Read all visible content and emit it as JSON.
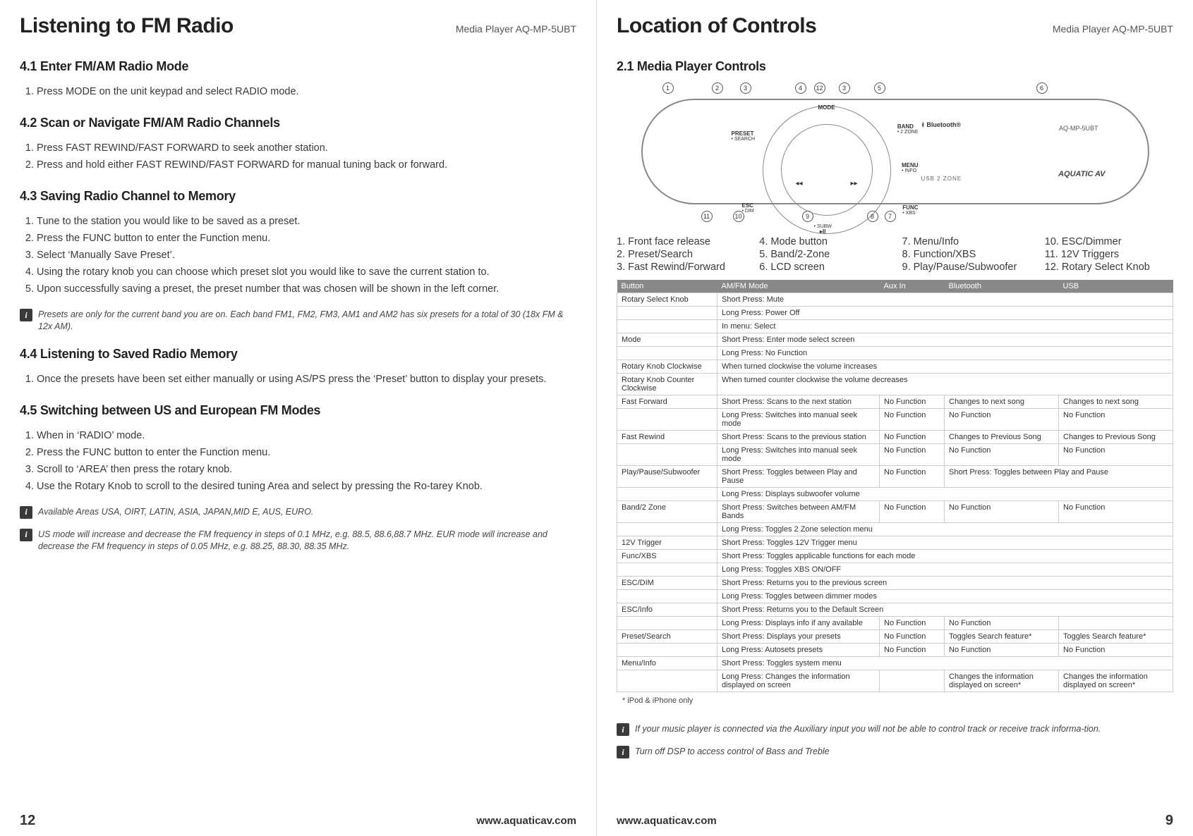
{
  "left": {
    "title": "Listening to FM Radio",
    "model": "Media Player AQ-MP-5UBT",
    "s41": "4.1 Enter FM/AM Radio Mode",
    "s41_1": "Press MODE on the unit keypad and select RADIO mode.",
    "s42": "4.2 Scan or Navigate FM/AM Radio Channels",
    "s42_1": "Press FAST REWIND/FAST FORWARD to seek another station.",
    "s42_2": "Press and hold either FAST REWIND/FAST FORWARD for manual tuning back or forward.",
    "s43": "4.3 Saving Radio Channel to Memory",
    "s43_1": "Tune to the station you would like to be saved as a preset.",
    "s43_2": "Press the FUNC button to enter the Function menu.",
    "s43_3": "Select ‘Manually Save Preset’.",
    "s43_4": "Using the rotary knob you can choose which preset slot you would like to save the current station to.",
    "s43_5": "Upon successfully saving a preset, the preset number that was chosen will be shown in the left corner.",
    "s43_note": "Presets are only for the current band you are on. Each band FM1, FM2, FM3, AM1 and AM2 has six presets for a total of 30 (18x FM & 12x AM).",
    "s44": "4.4 Listening to Saved Radio Memory",
    "s44_1": "Once the presets have been set either manually or using AS/PS press the ‘Preset’ button to display your presets.",
    "s45": "4.5 Switching between US and European FM Modes",
    "s45_1": "When in ‘RADIO’ mode.",
    "s45_2": "Press the FUNC button to enter the Function menu.",
    "s45_3": "Scroll to ‘AREA’ then press the rotary knob.",
    "s45_4": "Use the Rotary Knob to scroll to the desired tuning Area and select by pressing the Ro-tarey Knob.",
    "s45_note1": "Available Areas USA, OIRT, LATIN, ASIA, JAPAN,MID E, AUS, EURO.",
    "s45_note2": "US mode will increase and decrease the FM frequency in steps of 0.1 MHz, e.g. 88.5, 88.6,88.7 MHz. EUR mode will increase and decrease the FM frequency in steps of 0.05 MHz, e.g. 88.25, 88.30, 88.35 MHz.",
    "page_num": "12",
    "url": "www.aquaticav.com"
  },
  "right": {
    "title": "Location of Controls",
    "model": "Media Player AQ-MP-5UBT",
    "s21": "2.1 Media Player Controls",
    "device": {
      "model": "AQ-MP-5UBT",
      "brand": "AQUATIC AV",
      "bt": "Bluetooth",
      "usb2zone": "USB   2 ZONE",
      "knob": {
        "preset": "PRESET",
        "preset_sub": "• SEARCH",
        "mode": "MODE",
        "band": "BAND",
        "band_sub": "• 2 ZONE",
        "menu": "MENU",
        "menu_sub": "• INFO",
        "func": "FUNC",
        "func_sub": "• XBS",
        "subw": "• SUBW",
        "esc": "ESC",
        "esc_sub": "• DIM"
      }
    },
    "legend": {
      "c1a": "1. Front face release",
      "c1b": "2. Preset/Search",
      "c1c": "3. Fast Rewind/Forward",
      "c2a": "4. Mode button",
      "c2b": "5. Band/2-Zone",
      "c2c": "6. LCD screen",
      "c3a": "7. Menu/Info",
      "c3b": "8. Function/XBS",
      "c3c": "9. Play/Pause/Subwoofer",
      "c4a": "10. ESC/Dimmer",
      "c4b": "11. 12V Triggers",
      "c4c": "12. Rotary Select Knob"
    },
    "table": {
      "head": {
        "c1": "Button",
        "c2": "AM/FM Mode",
        "c3": "Aux In",
        "c4": "Bluetooth",
        "c5": "USB"
      },
      "rows": [
        {
          "c1": "Rotary Select Knob",
          "c2": "Short Press: Mute",
          "colspan": 4
        },
        {
          "c1": "",
          "c2": "Long Press: Power Off",
          "colspan": 4
        },
        {
          "c1": "",
          "c2": "In menu: Select",
          "colspan": 4
        },
        {
          "c1": "Mode",
          "c2": "Short Press: Enter mode select screen",
          "colspan": 4
        },
        {
          "c1": "",
          "c2": "Long Press: No Function",
          "colspan": 4
        },
        {
          "c1": "Rotary Knob Clockwise",
          "c2": "When turned clockwise the volume increases",
          "colspan": 4
        },
        {
          "c1": "Rotary Knob Counter Clockwise",
          "c2": "When turned counter clockwise the volume decreases",
          "colspan": 4
        },
        {
          "c1": "Fast Forward",
          "c2": "Short Press: Scans to the next station",
          "c3": "No Function",
          "c4": "Changes to next song",
          "c5": "Changes to next song"
        },
        {
          "c1": "",
          "c2": "Long Press: Switches into manual seek mode",
          "c3": "No Function",
          "c4": "No Function",
          "c5": "No Function"
        },
        {
          "c1": "Fast Rewind",
          "c2": "Short Press: Scans to the previous station",
          "c3": "No Function",
          "c4": "Changes to Previous Song",
          "c5": "Changes to Previous Song"
        },
        {
          "c1": "",
          "c2": "Long Press: Switches into manual seek mode",
          "c3": "No Function",
          "c4": "No Function",
          "c5": "No Function"
        },
        {
          "c1": "Play/Pause/Subwoofer",
          "c2": "Short Press: Toggles between Play and Pause",
          "c3": "No Function",
          "c45": "Short Press: Toggles between Play and Pause",
          "merge45": true
        },
        {
          "c1": "",
          "c2": "Long Press: Displays subwoofer volume",
          "colspan": 4
        },
        {
          "c1": "Band/2 Zone",
          "c2": "Short Press: Switches between AM/FM Bands",
          "c3": "No Function",
          "c4": "No Function",
          "c5": "No Function"
        },
        {
          "c1": "",
          "c2": "Long Press: Toggles 2 Zone selection menu",
          "colspan": 4
        },
        {
          "c1": "12V Trigger",
          "c2": "Short Press: Toggles 12V Trigger menu",
          "colspan": 4
        },
        {
          "c1": "Func/XBS",
          "c2": "Short Press: Toggles applicable functions for each mode",
          "colspan": 4
        },
        {
          "c1": "",
          "c2": "Long Press: Toggles XBS ON/OFF",
          "colspan": 4
        },
        {
          "c1": "ESC/DIM",
          "c2": "Short Press: Returns you to the previous screen",
          "colspan": 4
        },
        {
          "c1": "",
          "c2": "Long Press: Toggles between dimmer modes",
          "colspan": 4
        },
        {
          "c1": "ESC/Info",
          "c2": "Short Press: Returns you to the Default Screen",
          "colspan": 4
        },
        {
          "c1": "",
          "c2": "Long Press: Displays info if any available",
          "c3": "No Function",
          "c4": "No Function",
          "c5": ""
        },
        {
          "c1": "Preset/Search",
          "c2": "Short Press: Displays your presets",
          "c3": "No Function",
          "c4": "Toggles Search feature*",
          "c5": "Toggles Search feature*"
        },
        {
          "c1": "",
          "c2": "Long Press: Autosets presets",
          "c3": "No Function",
          "c4": "No Function",
          "c5": "No Function"
        },
        {
          "c1": "Menu/Info",
          "c2": "Short Press: Toggles system menu",
          "colspan": 4
        },
        {
          "c1": "",
          "c2": "Long Press: Changes the information displayed on screen",
          "c3": "",
          "c4": "Changes the information displayed on screen*",
          "c5": "Changes the information displayed on screen*"
        }
      ],
      "footnote": "* iPod & iPhone only"
    },
    "note1": "If your music player is connected via the Auxiliary input you will not be able to control track or receive track informa-tion.",
    "note2": "Turn off DSP to access control of Bass and Treble",
    "page_num": "9",
    "url": "www.aquaticav.com"
  },
  "info_glyph": "i"
}
